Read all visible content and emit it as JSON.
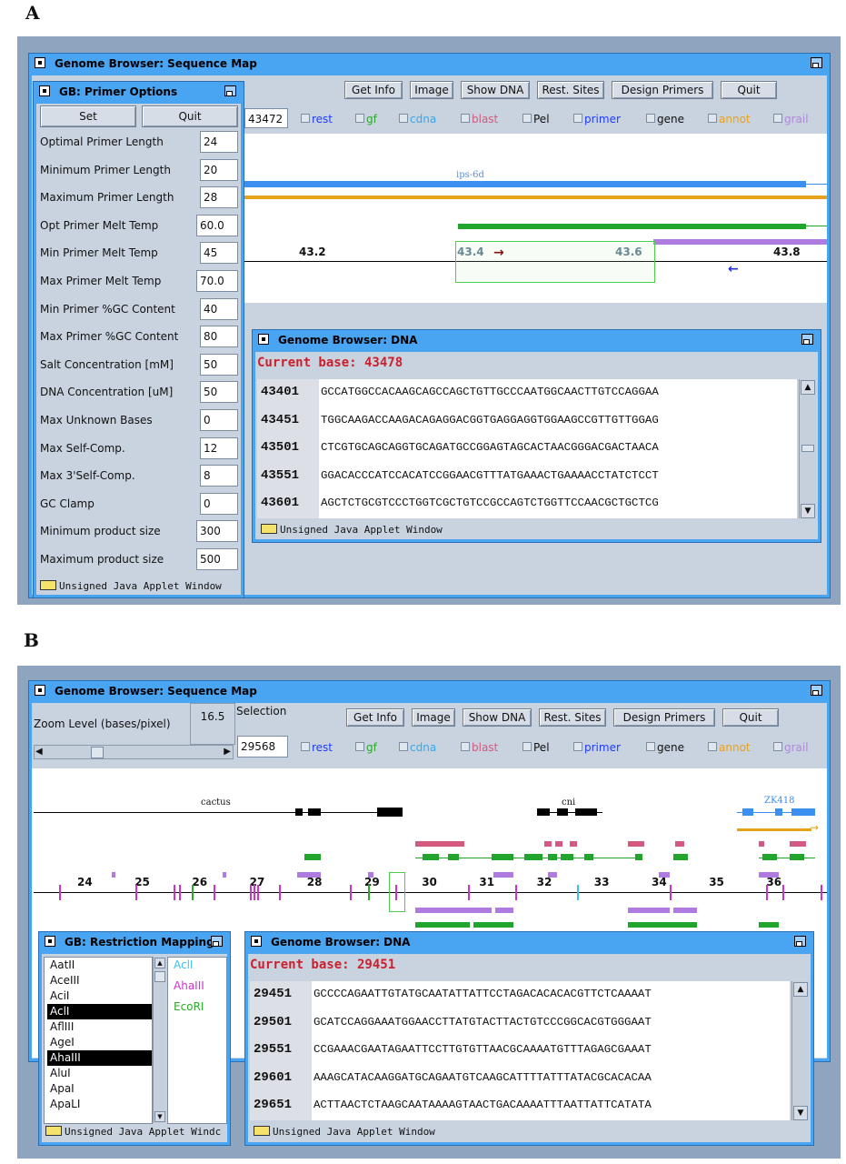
{
  "panel_a": {
    "label": "A",
    "main_window": {
      "title": "Genome Browser: Sequence Map",
      "buttons": [
        "Get Info",
        "Image",
        "Show DNA",
        "Rest. Sites",
        "Design Primers",
        "Quit"
      ],
      "position_field": "43472",
      "tracks": [
        {
          "label": "rest",
          "color": "#1e3cff"
        },
        {
          "label": "gf",
          "color": "#2aaa2a"
        },
        {
          "label": "cdna",
          "color": "#3aa7e6"
        },
        {
          "label": "blast",
          "color": "#d35a7e"
        },
        {
          "label": "Pel",
          "color": "#111111"
        },
        {
          "label": "primer",
          "color": "#1e3cff"
        },
        {
          "label": "gene",
          "color": "#111111"
        },
        {
          "label": "annot",
          "color": "#e8a21a"
        },
        {
          "label": "grail",
          "color": "#b089d8"
        }
      ],
      "gene_label": "ips-6d",
      "ruler_ticks": [
        "43.2",
        "43.4",
        "43.6",
        "43.8"
      ]
    },
    "primer_window": {
      "title": "GB: Primer Options",
      "set_label": "Set",
      "quit_label": "Quit",
      "params": [
        {
          "label": "Optimal Primer Length",
          "value": "24"
        },
        {
          "label": "Minimum Primer Length",
          "value": "20"
        },
        {
          "label": "Maximum Primer Length",
          "value": "28"
        },
        {
          "label": "Opt Primer Melt Temp",
          "value": "60.0"
        },
        {
          "label": "Min Primer Melt Temp",
          "value": "45"
        },
        {
          "label": "Max Primer Melt Temp",
          "value": "70.0"
        },
        {
          "label": "Min Primer %GC Content",
          "value": "40"
        },
        {
          "label": "Max Primer %GC Content",
          "value": "80"
        },
        {
          "label": "Salt Concentration [mM]",
          "value": "50"
        },
        {
          "label": "DNA Concentration [uM]",
          "value": "50"
        },
        {
          "label": "Max Unknown Bases",
          "value": "0"
        },
        {
          "label": "Max Self-Comp.",
          "value": "12"
        },
        {
          "label": "Max 3'Self-Comp.",
          "value": "8"
        },
        {
          "label": "GC Clamp",
          "value": "0"
        },
        {
          "label": "Minimum product size",
          "value": "300"
        },
        {
          "label": "Maximum product size",
          "value": "500"
        }
      ],
      "footer": "Unsigned Java Applet Window"
    },
    "dna_window": {
      "title": "Genome Browser: DNA",
      "current_base_label": "Current base: 43478",
      "rows": [
        {
          "pos": "43401",
          "seq": "GCCATGGCCACAAGCAGCCAGCTGTTGCCCAATGGCAACTTGTCCAGGAA"
        },
        {
          "pos": "43451",
          "seq": "TGGCAAGACCAAGACAGAGGACGGTGAGGAGGTGGAAGCCGTTGTTGGAG"
        },
        {
          "pos": "43501",
          "seq": "CTCGTGCAGCAGGTGCAGATGCCGGAGTAGCACTAACGGGACGACTAACA"
        },
        {
          "pos": "43551",
          "seq": "GGACACCCATCCACATCCGGAACGTTTATGAAACTGAAAACCTATCTCCT"
        },
        {
          "pos": "43601",
          "seq": "AGCTCTGCGTCCCTGGTCGCTGTCCGCCAGTCTGGTTCCAACGCTGCTCG"
        }
      ],
      "footer": "Unsigned Java Applet Window"
    }
  },
  "panel_b": {
    "label": "B",
    "main_window": {
      "title": "Genome Browser: Sequence Map",
      "zoom_label": "Zoom Level (bases/pixel)",
      "zoom_value": "16.5",
      "selection_label": "Selection",
      "position_field": "29568",
      "buttons": [
        "Get Info",
        "Image",
        "Show DNA",
        "Rest. Sites",
        "Design Primers",
        "Quit"
      ],
      "tracks": [
        {
          "label": "rest",
          "color": "#1e3cff"
        },
        {
          "label": "gf",
          "color": "#2aaa2a"
        },
        {
          "label": "cdna",
          "color": "#3aa7e6"
        },
        {
          "label": "blast",
          "color": "#d35a7e"
        },
        {
          "label": "Pel",
          "color": "#111111"
        },
        {
          "label": "primer",
          "color": "#1e3cff"
        },
        {
          "label": "gene",
          "color": "#111111"
        },
        {
          "label": "annot",
          "color": "#e8a21a"
        },
        {
          "label": "grail",
          "color": "#b089d8"
        }
      ],
      "gene_labels": [
        "cactus",
        "cni",
        "ZK418"
      ],
      "ruler_ticks": [
        "24",
        "25",
        "26",
        "27",
        "28",
        "29",
        "30",
        "31",
        "32",
        "33",
        "34",
        "35",
        "36"
      ]
    },
    "restriction_window": {
      "title": "GB: Restriction Mapping",
      "enzymes": [
        "AatII",
        "AceIII",
        "AciI",
        "AclI",
        "AflIII",
        "AgeI",
        "AhaIII",
        "AluI",
        "ApaI",
        "ApaLI"
      ],
      "selected": [
        "AclI",
        "AhaIII"
      ],
      "chosen": [
        {
          "name": "AclI",
          "color": "#3cc0e8"
        },
        {
          "name": "AhaIII",
          "color": "#cc33cc"
        },
        {
          "name": "EcoRI",
          "color": "#2aaa2a"
        }
      ],
      "footer": "Unsigned Java Applet Windc"
    },
    "dna_window": {
      "title": "Genome Browser: DNA",
      "current_base_label": "Current base: 29451",
      "rows": [
        {
          "pos": "29451",
          "seq": "GCCCCAGAATTGTATGCAATATTATTCCTAGACACACACGTTCTCAAAAT"
        },
        {
          "pos": "29501",
          "seq": "GCATCCAGGAAATGGAACCTTATGTACTTACTGTCCCGGCACGTGGGAAT"
        },
        {
          "pos": "29551",
          "seq": "CCGAAACGAATAGAATTCCTTGTGTTAACGCAAAATGTTTAGAGCGAAAT"
        },
        {
          "pos": "29601",
          "seq": "AAAGCATACAAGGATGCAGAATGTCAAGCATTTTATTTATACGCACACAA"
        },
        {
          "pos": "29651",
          "seq": "ACTTAACTCTAAGCAATAAAAGTAACTGACAAAATTTAATTATTCATATA"
        }
      ],
      "footer": "Unsigned Java Applet Window"
    }
  },
  "colors": {
    "title_bar": "#49a4f2",
    "client": "#c9d3df",
    "highlight": "#f8be1a",
    "current_base": "#cc1f2c"
  }
}
